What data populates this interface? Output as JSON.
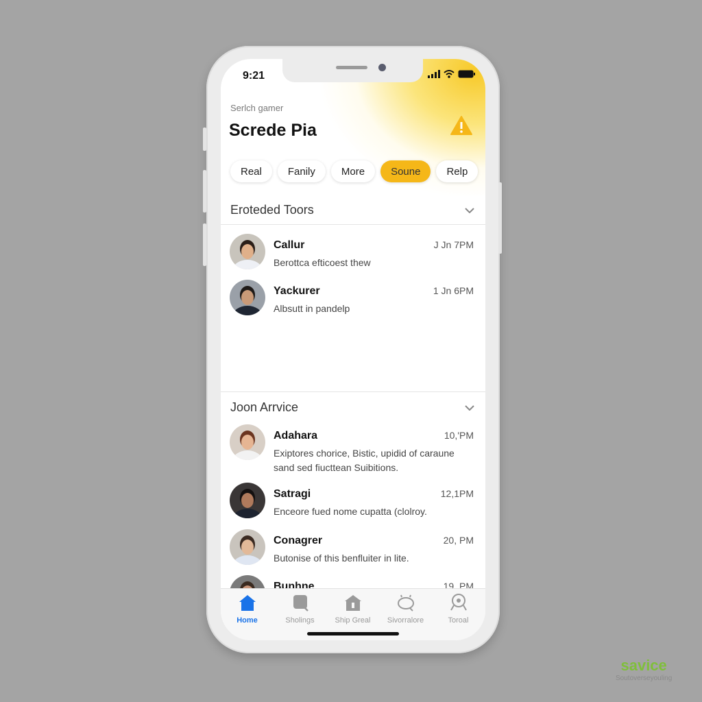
{
  "status_bar": {
    "time": "9:21"
  },
  "header": {
    "subtitle": "Serlch gamer",
    "title": "Screde Pia",
    "alert_icon": "warning-triangle-icon"
  },
  "chips": [
    {
      "label": "Real",
      "active": false
    },
    {
      "label": "Fanily",
      "active": false
    },
    {
      "label": "More",
      "active": false
    },
    {
      "label": "Soune",
      "active": true
    },
    {
      "label": "Relp",
      "active": false
    }
  ],
  "sections": [
    {
      "title": "Eroteded Toors",
      "items": [
        {
          "name": "Callur",
          "time": "J Jn 7PM",
          "message": "Berottca efticoest thew"
        },
        {
          "name": "Yackurer",
          "time": "1 Jn 6PM",
          "message": "Albsutt in pandelp"
        }
      ]
    },
    {
      "title": "Joon Arrvice",
      "items": [
        {
          "name": "Adahara",
          "time": "10,'PM",
          "message": "Exiptores chorice, Bistic, upidid of caraune sand sed fiucttean Suibitions."
        },
        {
          "name": "Satragi",
          "time": "12,1PM",
          "message": "Enceore fued nome cupatta (clolroy."
        },
        {
          "name": "Conagrer",
          "time": "20, PM",
          "message": "Butonise of this benfluiter in lite."
        },
        {
          "name": "Bunhne",
          "time": "19. PM",
          "message": ""
        }
      ]
    }
  ],
  "tabbar": [
    {
      "label": "Home",
      "icon": "home-icon",
      "active": true
    },
    {
      "label": "Sholings",
      "icon": "chat-icon",
      "active": false
    },
    {
      "label": "Ship Greal",
      "icon": "store-icon",
      "active": false
    },
    {
      "label": "Sivorralore",
      "icon": "message-bubble-icon",
      "active": false
    },
    {
      "label": "Toroal",
      "icon": "search-profile-icon",
      "active": false
    }
  ],
  "watermark": {
    "brand": "savice",
    "tagline": "Soutoverseyouling"
  },
  "colors": {
    "accent": "#f5b718",
    "active_tab": "#1a73e8",
    "background": "#a4a4a4"
  }
}
